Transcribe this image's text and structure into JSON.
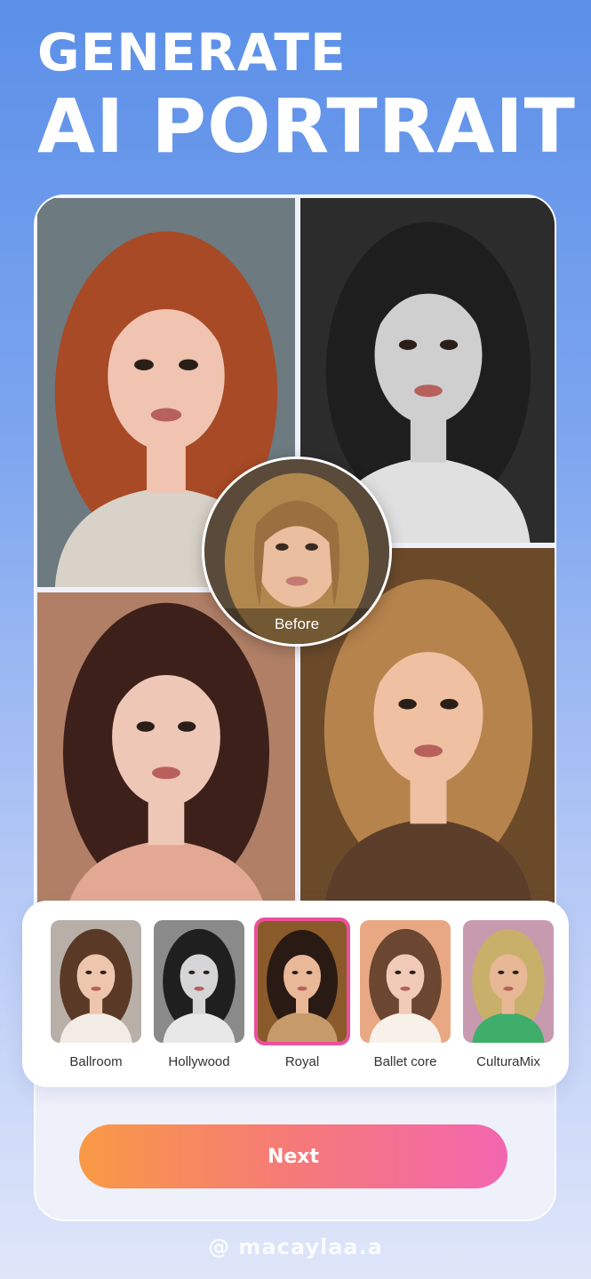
{
  "header": {
    "line1": "GENERATE",
    "line2": "AI PORTRAIT"
  },
  "showcase": {
    "before_label": "Before",
    "photos": [
      {
        "name": "red-hair-portrait",
        "palette": {
          "bg": "#6d7a80",
          "hair": "#a84a26",
          "skin": "#f0c4b0",
          "dress": "#d9d2c8"
        }
      },
      {
        "name": "hollywood-bw-portrait",
        "palette": {
          "bg": "#2c2c2c",
          "hair": "#1e1e1e",
          "skin": "#cfcfcf",
          "dress": "#e0e0e0"
        }
      },
      {
        "name": "ballet-portrait",
        "palette": {
          "bg": "#b07f66",
          "hair": "#3d2019",
          "skin": "#efc7b6",
          "dress": "#e3a894"
        }
      },
      {
        "name": "beret-portrait",
        "palette": {
          "bg": "#6b4a2a",
          "hair": "#b7834c",
          "skin": "#efc1a2",
          "dress": "#5b3e2a"
        }
      }
    ]
  },
  "styles": {
    "selected_index": 2,
    "items": [
      {
        "label": "Ballroom",
        "palette": {
          "bg": "#b8b0a8",
          "hair": "#5a3a26",
          "skin": "#eec6ae",
          "dress": "#f3ece6"
        }
      },
      {
        "label": "Hollywood",
        "palette": {
          "bg": "#8a8a8a",
          "hair": "#1f1f1f",
          "skin": "#d6d6d6",
          "dress": "#e8e8e8"
        }
      },
      {
        "label": "Royal",
        "palette": {
          "bg": "#8a5a2a",
          "hair": "#2a1a14",
          "skin": "#e9b898",
          "dress": "#c79a6a"
        }
      },
      {
        "label": "Ballet core",
        "palette": {
          "bg": "#e9a884",
          "hair": "#6b4630",
          "skin": "#f1cbb8",
          "dress": "#f8f1ea"
        }
      },
      {
        "label": "CulturaMix",
        "palette": {
          "bg": "#c79ab0",
          "hair": "#c9b06a",
          "skin": "#e7b796",
          "dress": "#3eae6a"
        }
      }
    ]
  },
  "actions": {
    "next_label": "Next"
  },
  "footer": {
    "watermark": "@ macaylaa.a"
  },
  "colors": {
    "accent_pink": "#ec4f9c",
    "button_start": "#f99945",
    "button_end": "#f366b0",
    "background_top": "#5b8fe8"
  }
}
